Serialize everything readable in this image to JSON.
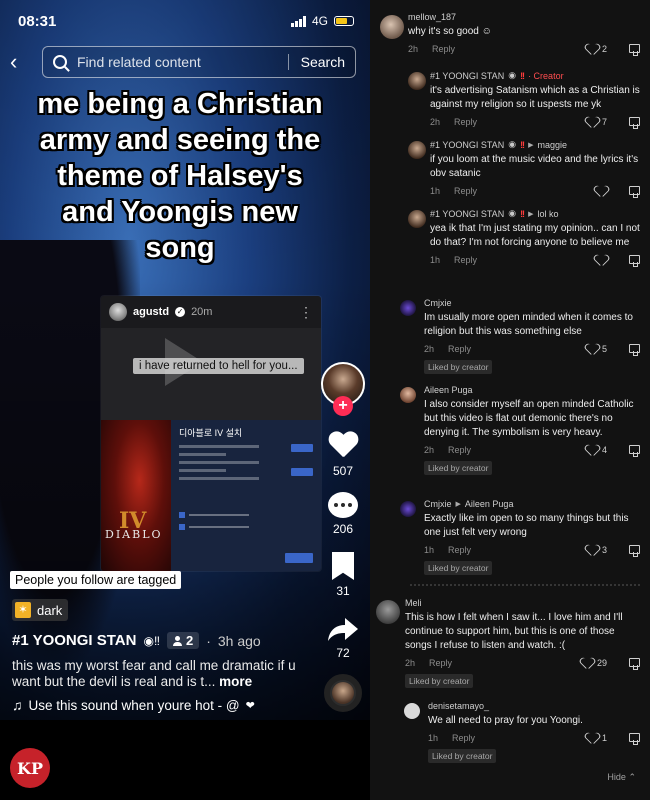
{
  "status_bar": {
    "time": "08:31",
    "network": "4G"
  },
  "search": {
    "placeholder": "Find related content",
    "button": "Search"
  },
  "overlay_lines": [
    "me being a Christian",
    "army and seeing the",
    "theme of Halsey's",
    "and Yoongis new",
    "song"
  ],
  "embed": {
    "username": "agustd",
    "time": "20m",
    "caption": "i have returned to hell for you...",
    "game_title": "DIABLO",
    "game_numeral": "IV",
    "panel_title": "디아블로 IV 설치"
  },
  "rail": {
    "likes": "507",
    "comments": "206",
    "saves": "31",
    "shares": "72"
  },
  "tagged_notice": "People you follow are tagged",
  "effect": {
    "label": "dark"
  },
  "author": {
    "name": "#1 YOONGI STAN",
    "friends": "2",
    "time": "3h ago"
  },
  "description": {
    "text": "this was my worst fear and call me dramatic if u want but the devil is real and is t...",
    "more": "more"
  },
  "sound": {
    "label": "Use this sound when youre hot - @"
  },
  "watermark": "KP",
  "comments": {
    "c1": {
      "name": "mellow_187",
      "text": "why it's so good ☺",
      "time": "2h",
      "reply": "Reply",
      "likes": "2"
    },
    "c2": {
      "name": "#1 YOONGI STAN",
      "creator": "· Creator",
      "text": "it's advertising Satanism which as a Christian is against my religion so it uspests me yk",
      "time": "2h",
      "reply": "Reply",
      "likes": "7"
    },
    "c3": {
      "name": "#1 YOONGI STAN",
      "to": "maggie",
      "text": "if you loom at the music video and the lyrics it's obv satanic",
      "time": "1h",
      "reply": "Reply",
      "likes": ""
    },
    "c4": {
      "name": "#1 YOONGI STAN",
      "to": "lol ko",
      "text": "yea ik that I'm just stating my opinion.. can I not do that? I'm not forcing anyone to believe me",
      "time": "1h",
      "reply": "Reply",
      "likes": ""
    },
    "c5": {
      "name": "Cmjxie",
      "text": "Im usually more open minded when it comes to religion but this was something else",
      "time": "2h",
      "reply": "Reply",
      "likes": "5",
      "liked_by": "Liked by creator"
    },
    "c6": {
      "name": "Aileen Puga",
      "text": "I also consider myself an open minded Catholic but this video is flat out demonic there's no denying it. The symbolism is very heavy.",
      "time": "2h",
      "reply": "Reply",
      "likes": "4",
      "liked_by": "Liked by creator"
    },
    "c7": {
      "name": "Cmjxie",
      "to": "Aileen Puga",
      "text": "Exactly like im open to so many things but this one just felt very wrong",
      "time": "1h",
      "reply": "Reply",
      "likes": "3",
      "liked_by": "Liked by creator"
    },
    "c8": {
      "name": "Meli",
      "text": "This is how I felt when I saw it... I love him and I'll continue to support him, but this is one of those songs I refuse to listen and watch. :(",
      "time": "2h",
      "reply": "Reply",
      "likes": "29",
      "liked_by": "Liked by creator"
    },
    "c9": {
      "name": "denisetamayo_",
      "text": "We all need to pray for you Yoongi.",
      "time": "1h",
      "reply": "Reply",
      "likes": "1",
      "liked_by": "Liked by creator"
    }
  },
  "hide_label": "Hide",
  "colors": {
    "accent": "#fe2c55",
    "creator_tag": "#ff4d4f",
    "comments_bg": "#121212"
  }
}
